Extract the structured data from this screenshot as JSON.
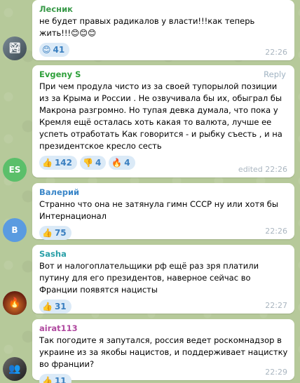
{
  "messages": [
    {
      "author": "Лесник",
      "author_color": "#3a9a4a",
      "text": "не будет  правых радикалов у власти!!!как теперь жить!!!😊😊😊",
      "reactions": [
        {
          "emoji": "😊",
          "count": "41"
        }
      ],
      "time": "22:26",
      "avatar": {
        "initials": "",
        "color": "#5a6670"
      }
    },
    {
      "author": "Evgeny S",
      "author_color": "#2ea03a",
      "reply_label": "Reply",
      "text": "При чем продула чисто из за своей тупорылой позиции из за Крыма и России . Не озвучивала бы их, обыграл бы Макрона разгромно. Но тупая девка думала, что пока у Кремля ещё осталась хоть какая то валюта, лучше ее успеть отработать Как говорится - и рыбку съесть , и на президентское кресло сесть",
      "reactions": [
        {
          "emoji": "👍",
          "count": "142"
        },
        {
          "emoji": "👎",
          "count": "4"
        },
        {
          "emoji": "🔥",
          "count": "4"
        }
      ],
      "time": "edited 22:26",
      "avatar": {
        "initials": "ES",
        "color": "#5bbf6a"
      }
    },
    {
      "author": "Валерий",
      "author_color": "#3a86c8",
      "text": "Странно что она не затянула гимн СССР ну или хотя бы Интернационал",
      "reactions": [
        {
          "emoji": "👍",
          "count": "75"
        }
      ],
      "time": "22:26",
      "avatar": {
        "initials": "B",
        "color": "#5a9be0"
      }
    },
    {
      "author": "Sasha",
      "author_color": "#2aa0a8",
      "text": "Вот  и налогоплательщики рф  ещё раз зря платили путину для его президентов, наверное сейчас во Франции появятся нацисты",
      "reactions": [
        {
          "emoji": "👍",
          "count": "31"
        }
      ],
      "time": "22:27",
      "avatar": {
        "initials": "",
        "color": "#8a3a1a"
      }
    },
    {
      "author": "airat113",
      "author_color": "#b04aa0",
      "text": "Так погодите я запутался, россия ведет роскомнадзор в украине из за якобы нацистов, и поддерживает нацистку во франции?",
      "reactions": [
        {
          "emoji": "👍",
          "count": "11"
        }
      ],
      "time": "22:29",
      "avatar": {
        "initials": "",
        "color": "#3a3a3a"
      }
    }
  ]
}
